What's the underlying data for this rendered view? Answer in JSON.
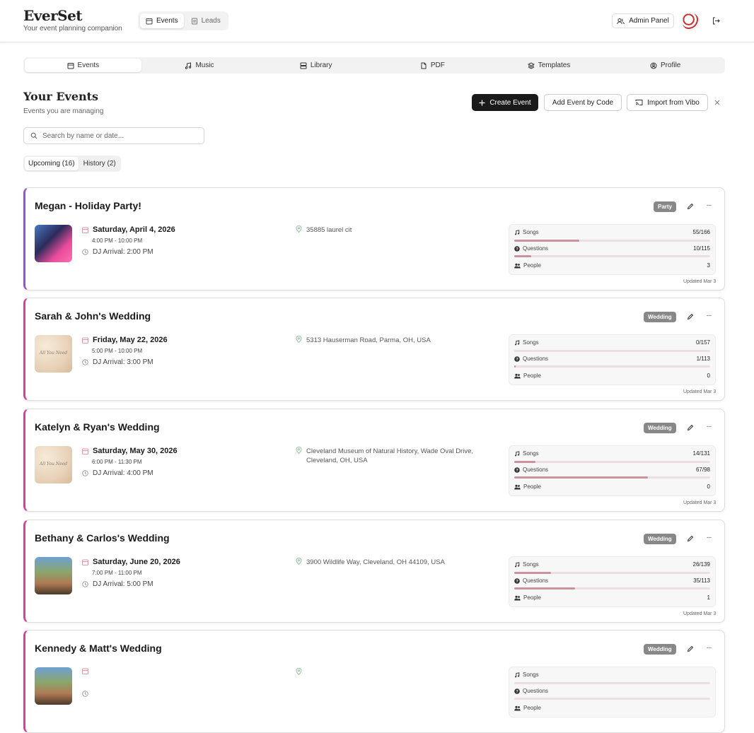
{
  "app": {
    "name": "EverSet",
    "tagline": "Your event planning companion"
  },
  "topnav": [
    {
      "label": "Events",
      "active": true
    },
    {
      "label": "Leads",
      "active": false
    }
  ],
  "admin_label": "Admin Panel",
  "tabs": [
    {
      "label": "Events",
      "icon": "calendar-icon",
      "active": true
    },
    {
      "label": "Music",
      "icon": "music-icon",
      "active": false
    },
    {
      "label": "Library",
      "icon": "library-icon",
      "active": false
    },
    {
      "label": "PDF",
      "icon": "pdf-icon",
      "active": false
    },
    {
      "label": "Templates",
      "icon": "layers-icon",
      "active": false
    },
    {
      "label": "Profile",
      "icon": "profile-icon",
      "active": false
    }
  ],
  "section": {
    "title": "Your Events",
    "subtitle": "Events you are managing"
  },
  "actions": {
    "create": "Create Event",
    "code": "Add Event by Code",
    "vibo": "Import from Vibo"
  },
  "search": {
    "placeholder": "Search by name or date...",
    "value": ""
  },
  "filters": [
    {
      "label": "Upcoming (16)",
      "active": true
    },
    {
      "label": "History (2)",
      "active": false
    }
  ],
  "stat_labels": {
    "songs": "Songs",
    "questions": "Questions",
    "people": "People"
  },
  "events": [
    {
      "title": "Megan - Holiday Party!",
      "badge": "Party",
      "date": "Saturday, April 4, 2026",
      "time": "4:00 PM - 10:00 PM",
      "arrival": "DJ Arrival: 2:00 PM",
      "location": "35885 laurel cit",
      "songs": "55/166",
      "songs_frac": 0.331,
      "questions": "10/115",
      "questions_frac": 0.087,
      "people": "3",
      "updated": "Updated Mar 3",
      "thumb": "photo1",
      "thumb_text": ""
    },
    {
      "title": "Sarah & John's Wedding",
      "badge": "Wedding",
      "date": "Friday, May 22, 2026",
      "time": "5:00 PM - 10:00 PM",
      "arrival": "DJ Arrival: 3:00 PM",
      "location": "5313 Hauserman Road, Parma, OH, USA",
      "songs": "0/157",
      "songs_frac": 0.0,
      "questions": "1/113",
      "questions_frac": 0.009,
      "people": "0",
      "updated": "Updated Mar 3",
      "thumb": "photo2",
      "thumb_text": "All You Need"
    },
    {
      "title": "Katelyn & Ryan's Wedding",
      "badge": "Wedding",
      "date": "Saturday, May 30, 2026",
      "time": "6:00 PM - 11:30 PM",
      "arrival": "DJ Arrival: 4:00 PM",
      "location": "Cleveland Museum of Natural History, Wade Oval Drive, Cleveland, OH, USA",
      "songs": "14/131",
      "songs_frac": 0.107,
      "questions": "67/98",
      "questions_frac": 0.684,
      "people": "0",
      "updated": "Updated Mar 3",
      "thumb": "photo2",
      "thumb_text": "All You Need"
    },
    {
      "title": "Bethany & Carlos's Wedding",
      "badge": "Wedding",
      "date": "Saturday, June 20, 2026",
      "time": "7:00 PM - 11:00 PM",
      "arrival": "DJ Arrival: 5:00 PM",
      "location": "3900 Wildlife Way, Cleveland, OH 44109, USA",
      "songs": "26/139",
      "songs_frac": 0.187,
      "questions": "35/113",
      "questions_frac": 0.31,
      "people": "1",
      "updated": "Updated Mar 3",
      "thumb": "photo3",
      "thumb_text": ""
    },
    {
      "title": "Kennedy & Matt's Wedding",
      "badge": "Wedding",
      "date": "",
      "time": "",
      "arrival": "",
      "location": "",
      "songs": "",
      "songs_frac": 0,
      "questions": "",
      "questions_frac": 0,
      "people": "",
      "updated": "",
      "thumb": "photo3",
      "thumb_text": ""
    }
  ],
  "colors": {
    "accent_pink": "#d63fa0",
    "accent_purple": "#9b4fd6",
    "progress_fill": "#c9939c",
    "progress_track": "#ecdfe2",
    "badge": "#888888"
  }
}
